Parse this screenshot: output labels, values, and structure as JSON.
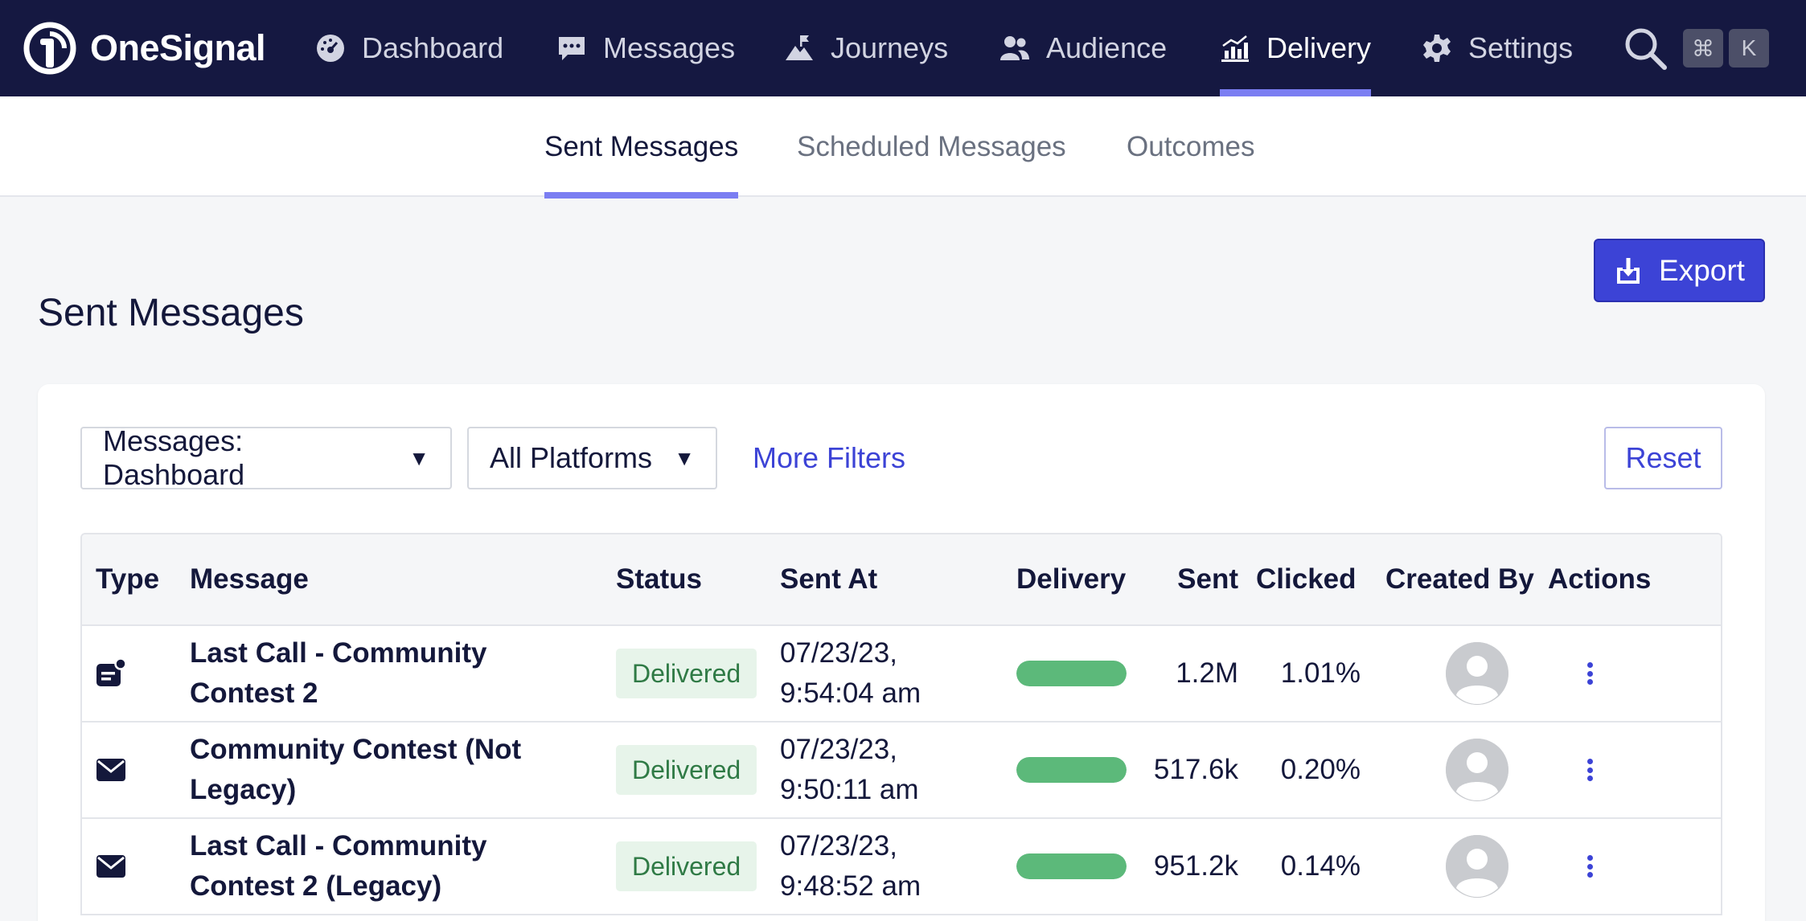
{
  "brand": {
    "name": "OneSignal"
  },
  "nav": {
    "items": [
      {
        "label": "Dashboard",
        "icon": "speedometer-icon"
      },
      {
        "label": "Messages",
        "icon": "chat-bubble-icon"
      },
      {
        "label": "Journeys",
        "icon": "mountain-flag-icon"
      },
      {
        "label": "Audience",
        "icon": "users-icon"
      },
      {
        "label": "Delivery",
        "icon": "bar-chart-icon",
        "active": true
      },
      {
        "label": "Settings",
        "icon": "gear-icon"
      }
    ],
    "shortcut": {
      "key1": "⌘",
      "key2": "K"
    }
  },
  "subtabs": [
    {
      "label": "Sent Messages",
      "active": true
    },
    {
      "label": "Scheduled Messages"
    },
    {
      "label": "Outcomes"
    }
  ],
  "page": {
    "title": "Sent Messages",
    "export_label": "Export"
  },
  "filters": {
    "messages_select": "Messages: Dashboard",
    "platforms_select": "All Platforms",
    "more_filters": "More Filters",
    "reset": "Reset"
  },
  "table": {
    "columns": [
      "Type",
      "Message",
      "Status",
      "Sent At",
      "Delivery",
      "Sent",
      "Clicked",
      "Created By",
      "Actions"
    ],
    "rows": [
      {
        "type": "in-app-message-icon",
        "message_line1": "Last Call - Community",
        "message_line2": "Contest 2",
        "status": "Delivered",
        "sent_at_line1": "07/23/23,",
        "sent_at_line2": "9:54:04 am",
        "delivery_pct": 100,
        "sent": "1.2M",
        "clicked": "1.01%"
      },
      {
        "type": "email-icon",
        "message_line1": "Community Contest (Not",
        "message_line2": "Legacy)",
        "status": "Delivered",
        "sent_at_line1": "07/23/23,",
        "sent_at_line2": "9:50:11 am",
        "delivery_pct": 100,
        "sent": "517.6k",
        "clicked": "0.20%"
      },
      {
        "type": "email-icon",
        "message_line1": "Last Call - Community",
        "message_line2": "Contest 2 (Legacy)",
        "status": "Delivered",
        "sent_at_line1": "07/23/23,",
        "sent_at_line2": "9:48:52 am",
        "delivery_pct": 100,
        "sent": "951.2k",
        "clicked": "0.14%"
      }
    ]
  },
  "colors": {
    "nav_bg": "#151841",
    "accent": "#3c43d6",
    "underline": "#7b7ef2",
    "delivered_bar": "#5cb97a"
  }
}
